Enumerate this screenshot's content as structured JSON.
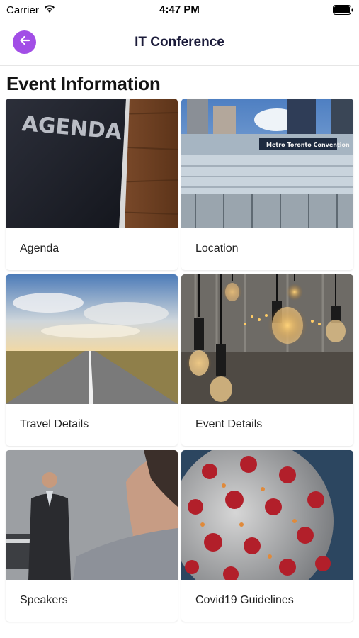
{
  "status_bar": {
    "carrier": "Carrier",
    "time": "4:47 PM",
    "wifi_icon": "wifi-icon",
    "battery_icon": "battery-icon"
  },
  "nav": {
    "title": "IT Conference",
    "back_icon": "arrow-left-icon",
    "accent_color": "#a24ee6"
  },
  "section": {
    "title": "Event Information"
  },
  "cards": [
    {
      "label": "Agenda",
      "image": "agenda-book-photo"
    },
    {
      "label": "Location",
      "image": "convention-centre-photo"
    },
    {
      "label": "Travel Details",
      "image": "open-road-photo"
    },
    {
      "label": "Event Details",
      "image": "hanging-bulbs-photo"
    },
    {
      "label": "Speakers",
      "image": "speaker-presenting-photo"
    },
    {
      "label": "Covid19 Guidelines",
      "image": "virus-photo"
    }
  ]
}
